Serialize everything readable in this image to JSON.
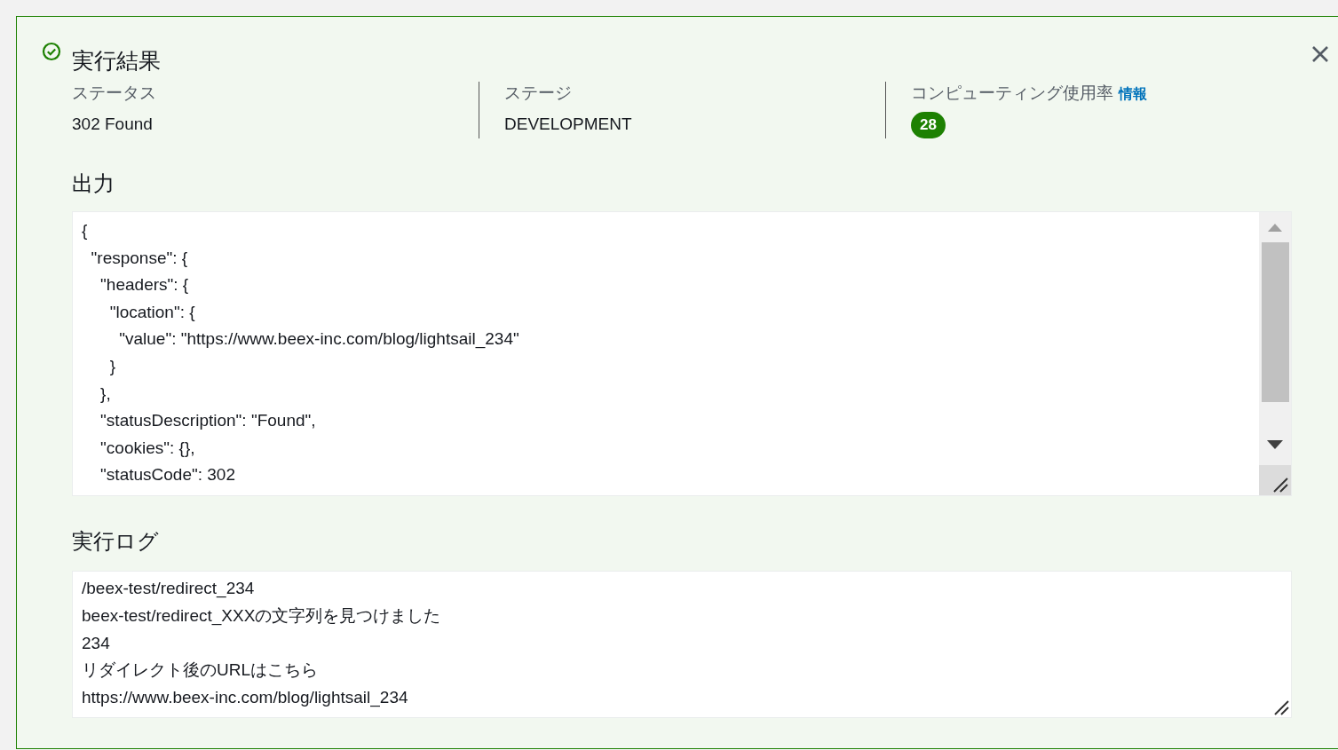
{
  "result": {
    "title": "実行結果",
    "succeeded": true
  },
  "summary": [
    {
      "label": "ステータス",
      "value": "302 Found",
      "kind": "text"
    },
    {
      "label": "ステージ",
      "value": "DEVELOPMENT",
      "kind": "text"
    },
    {
      "label": "コンピューティング使用率",
      "info_link": "情報",
      "value": "28",
      "kind": "badge"
    }
  ],
  "output": {
    "heading": "出力",
    "lines": [
      "{",
      "  \"response\": {",
      "    \"headers\": {",
      "      \"location\": {",
      "        \"value\": \"https://www.beex-inc.com/blog/lightsail_234\"",
      "      }",
      "    },",
      "    \"statusDescription\": \"Found\",",
      "    \"cookies\": {},",
      "    \"statusCode\": 302"
    ]
  },
  "log": {
    "heading": "実行ログ",
    "lines": [
      "/beex-test/redirect_234",
      "beex-test/redirect_XXXの文字列を見つけました",
      "234",
      "リダイレクト後のURLはこちら",
      "https://www.beex-inc.com/blog/lightsail_234"
    ]
  }
}
